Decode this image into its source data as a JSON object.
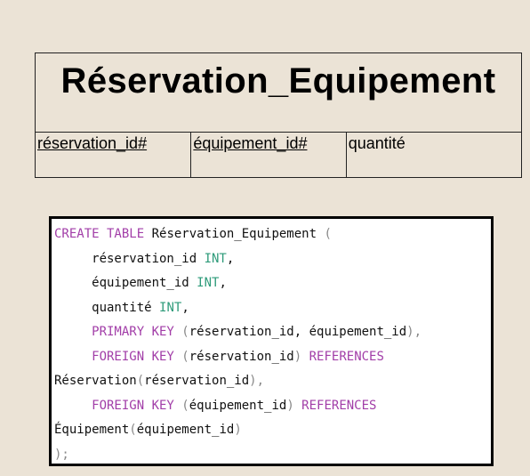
{
  "entity": {
    "title": "Réservation_Equipement",
    "fields": [
      {
        "label": "réservation_id#",
        "key": true
      },
      {
        "label": "équipement_id#",
        "key": true
      },
      {
        "label": "quantité",
        "key": false
      }
    ]
  },
  "sql": {
    "lines": [
      [
        {
          "t": "CREATE TABLE",
          "c": "kw"
        },
        {
          "t": " Réservation_Equipement ",
          "c": "tx"
        },
        {
          "t": "(",
          "c": "pn"
        }
      ],
      [
        {
          "t": "     réservation_id ",
          "c": "tx"
        },
        {
          "t": "INT",
          "c": "ty"
        },
        {
          "t": ",",
          "c": "tx"
        }
      ],
      [
        {
          "t": "     équipement_id ",
          "c": "tx"
        },
        {
          "t": "INT",
          "c": "ty"
        },
        {
          "t": ",",
          "c": "tx"
        }
      ],
      [
        {
          "t": "     quantité ",
          "c": "tx"
        },
        {
          "t": "INT",
          "c": "ty"
        },
        {
          "t": ",",
          "c": "tx"
        }
      ],
      [
        {
          "t": "     PRIMARY KEY ",
          "c": "kw"
        },
        {
          "t": "(",
          "c": "pn"
        },
        {
          "t": "réservation_id, équipement_id",
          "c": "tx"
        },
        {
          "t": "),",
          "c": "pn"
        }
      ],
      [
        {
          "t": "     FOREIGN KEY ",
          "c": "kw"
        },
        {
          "t": "(",
          "c": "pn"
        },
        {
          "t": "réservation_id",
          "c": "tx"
        },
        {
          "t": ")",
          "c": "pn"
        },
        {
          "t": " REFERENCES",
          "c": "kw"
        }
      ],
      [
        {
          "t": "Réservation",
          "c": "tx"
        },
        {
          "t": "(",
          "c": "pn"
        },
        {
          "t": "réservation_id",
          "c": "tx"
        },
        {
          "t": "),",
          "c": "pn"
        }
      ],
      [
        {
          "t": "     FOREIGN KEY ",
          "c": "kw"
        },
        {
          "t": "(",
          "c": "pn"
        },
        {
          "t": "équipement_id",
          "c": "tx"
        },
        {
          "t": ")",
          "c": "pn"
        },
        {
          "t": " REFERENCES",
          "c": "kw"
        }
      ],
      [
        {
          "t": "Équipement",
          "c": "tx"
        },
        {
          "t": "(",
          "c": "pn"
        },
        {
          "t": "équipement_id",
          "c": "tx"
        },
        {
          "t": ")",
          "c": "pn"
        }
      ],
      [
        {
          "t": ");",
          "c": "pn"
        }
      ]
    ]
  },
  "colors": {
    "background": "#ebe3d6",
    "keyword": "#a23ea8",
    "type": "#2e9b7a",
    "punctuation": "#888888"
  }
}
